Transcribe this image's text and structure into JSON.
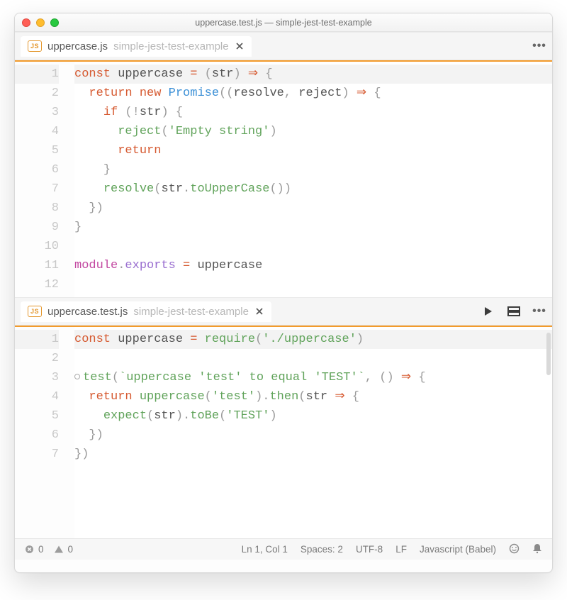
{
  "window": {
    "title": "uppercase.test.js — simple-jest-test-example"
  },
  "panes": [
    {
      "tab": {
        "badge": "JS",
        "filename": "uppercase.js",
        "project": "simple-jest-test-example"
      },
      "actions": {
        "more": "•••"
      }
    },
    {
      "tab": {
        "badge": "JS",
        "filename": "uppercase.test.js",
        "project": "simple-jest-test-example"
      },
      "actions": {
        "run": "▶",
        "layout": "▭",
        "more": "•••"
      }
    }
  ],
  "code": {
    "upper": [
      {
        "n": 1,
        "hl": true,
        "tokens": [
          [
            "kw",
            "const"
          ],
          [
            "",
            null
          ],
          [
            "ident",
            "uppercase"
          ],
          [
            "",
            null
          ],
          [
            "op",
            "="
          ],
          [
            "",
            null
          ],
          [
            "punc",
            "("
          ],
          [
            "ident",
            "str"
          ],
          [
            "punc",
            ")"
          ],
          [
            "",
            null
          ],
          [
            "op",
            "⇒"
          ],
          [
            "",
            null
          ],
          [
            "punc",
            "{"
          ]
        ],
        "indent": 0
      },
      {
        "n": 2,
        "tokens": [
          [
            "kw",
            "return"
          ],
          [
            "",
            null
          ],
          [
            "kw",
            "new"
          ],
          [
            "",
            null
          ],
          [
            "cls",
            "Promise"
          ],
          [
            "punc",
            "(("
          ],
          [
            "ident",
            "resolve"
          ],
          [
            "punc",
            ","
          ],
          [
            "",
            null
          ],
          [
            "ident",
            "reject"
          ],
          [
            "punc",
            ")"
          ],
          [
            "",
            null
          ],
          [
            "op",
            "⇒"
          ],
          [
            "",
            null
          ],
          [
            "punc",
            "{"
          ]
        ],
        "indent": 1
      },
      {
        "n": 3,
        "tokens": [
          [
            "kw",
            "if"
          ],
          [
            "",
            null
          ],
          [
            "punc",
            "(!"
          ],
          [
            "ident",
            "str"
          ],
          [
            "punc",
            ")"
          ],
          [
            "",
            null
          ],
          [
            "punc",
            "{"
          ]
        ],
        "indent": 2
      },
      {
        "n": 4,
        "tokens": [
          [
            "fn",
            "reject"
          ],
          [
            "punc",
            "("
          ],
          [
            "str",
            "'Empty string'"
          ],
          [
            "punc",
            ")"
          ]
        ],
        "indent": 3
      },
      {
        "n": 5,
        "tokens": [
          [
            "kw",
            "return"
          ]
        ],
        "indent": 3
      },
      {
        "n": 6,
        "tokens": [
          [
            "punc",
            "}"
          ]
        ],
        "indent": 2
      },
      {
        "n": 7,
        "tokens": [
          [
            "fn",
            "resolve"
          ],
          [
            "punc",
            "("
          ],
          [
            "ident",
            "str"
          ],
          [
            "punc",
            "."
          ],
          [
            "fn",
            "toUpperCase"
          ],
          [
            "punc",
            "())"
          ]
        ],
        "indent": 2
      },
      {
        "n": 8,
        "tokens": [
          [
            "punc",
            "})"
          ]
        ],
        "indent": 1
      },
      {
        "n": 9,
        "tokens": [
          [
            "punc",
            "}"
          ]
        ],
        "indent": 0
      },
      {
        "n": 10,
        "tokens": [],
        "indent": 0
      },
      {
        "n": 11,
        "tokens": [
          [
            "module",
            "module"
          ],
          [
            "punc",
            "."
          ],
          [
            "modkey",
            "exports"
          ],
          [
            "",
            null
          ],
          [
            "op",
            "="
          ],
          [
            "",
            null
          ],
          [
            "ident",
            "uppercase"
          ]
        ],
        "indent": 0
      },
      {
        "n": 12,
        "tokens": [],
        "indent": 0
      }
    ],
    "test": [
      {
        "n": 1,
        "hl": true,
        "tokens": [
          [
            "kw",
            "const"
          ],
          [
            "",
            null
          ],
          [
            "ident",
            "uppercase"
          ],
          [
            "",
            null
          ],
          [
            "op",
            "="
          ],
          [
            "",
            null
          ],
          [
            "fn",
            "require"
          ],
          [
            "punc",
            "("
          ],
          [
            "str",
            "'./uppercase'"
          ],
          [
            "punc",
            ")"
          ]
        ],
        "indent": 0
      },
      {
        "n": 2,
        "tokens": [],
        "indent": 0
      },
      {
        "n": 3,
        "mark": "test",
        "tokens": [
          [
            "fn",
            "test"
          ],
          [
            "punc",
            "("
          ],
          [
            "str",
            "`uppercase 'test' to equal 'TEST'`"
          ],
          [
            "punc",
            ","
          ],
          [
            "",
            null
          ],
          [
            "punc",
            "()"
          ],
          [
            "",
            null
          ],
          [
            "op",
            "⇒"
          ],
          [
            "",
            null
          ],
          [
            "punc",
            "{"
          ]
        ],
        "indent": 0
      },
      {
        "n": 4,
        "tokens": [
          [
            "kw",
            "return"
          ],
          [
            "",
            null
          ],
          [
            "fn",
            "uppercase"
          ],
          [
            "punc",
            "("
          ],
          [
            "str",
            "'test'"
          ],
          [
            "punc",
            ")."
          ],
          [
            "fn",
            "then"
          ],
          [
            "punc",
            "("
          ],
          [
            "ident",
            "str"
          ],
          [
            "",
            null
          ],
          [
            "op",
            "⇒"
          ],
          [
            "",
            null
          ],
          [
            "punc",
            "{"
          ]
        ],
        "indent": 1
      },
      {
        "n": 5,
        "tokens": [
          [
            "fn",
            "expect"
          ],
          [
            "punc",
            "("
          ],
          [
            "ident",
            "str"
          ],
          [
            "punc",
            ")."
          ],
          [
            "fn",
            "toBe"
          ],
          [
            "punc",
            "("
          ],
          [
            "str",
            "'TEST'"
          ],
          [
            "punc",
            ")"
          ]
        ],
        "indent": 2
      },
      {
        "n": 6,
        "tokens": [
          [
            "punc",
            "})"
          ]
        ],
        "indent": 1
      },
      {
        "n": 7,
        "tokens": [
          [
            "punc",
            "})"
          ]
        ],
        "indent": 0
      }
    ]
  },
  "statusbar": {
    "errors": "0",
    "warnings": "0",
    "position": "Ln 1, Col 1",
    "spaces": "Spaces: 2",
    "encoding": "UTF-8",
    "eol": "LF",
    "lang": "Javascript (Babel)"
  }
}
